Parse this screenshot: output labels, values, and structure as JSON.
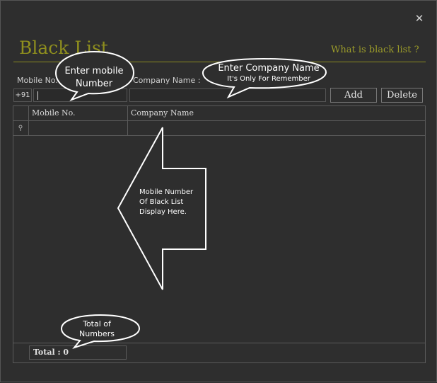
{
  "window": {
    "title": "Black List",
    "help_link": "What is black list ?",
    "close_glyph": "✕"
  },
  "form": {
    "mobile_label": "Mobile No. :",
    "company_label": "Company Name :",
    "country_code": "+91",
    "mobile_value": "",
    "company_value": "",
    "add_button": "Add",
    "delete_button": "Delete"
  },
  "grid": {
    "columns": [
      "Mobile No.",
      "Company Name"
    ],
    "new_row_icon": "new-row-icon",
    "total_label": "Total : 0"
  },
  "callouts": {
    "mobile_line1": "Enter mobile",
    "mobile_line2": "Number",
    "company_line1": "Enter Company Name",
    "company_line2": "It's Only For Remember",
    "arrow_line1": "Mobile Number",
    "arrow_line2": "Of Black List",
    "arrow_line3": "Display Here.",
    "total_line1": "Total of",
    "total_line2": "Numbers"
  },
  "colors": {
    "title": "#8f8f1e",
    "rule": "#8a8a20",
    "background": "#2e2e2e"
  }
}
